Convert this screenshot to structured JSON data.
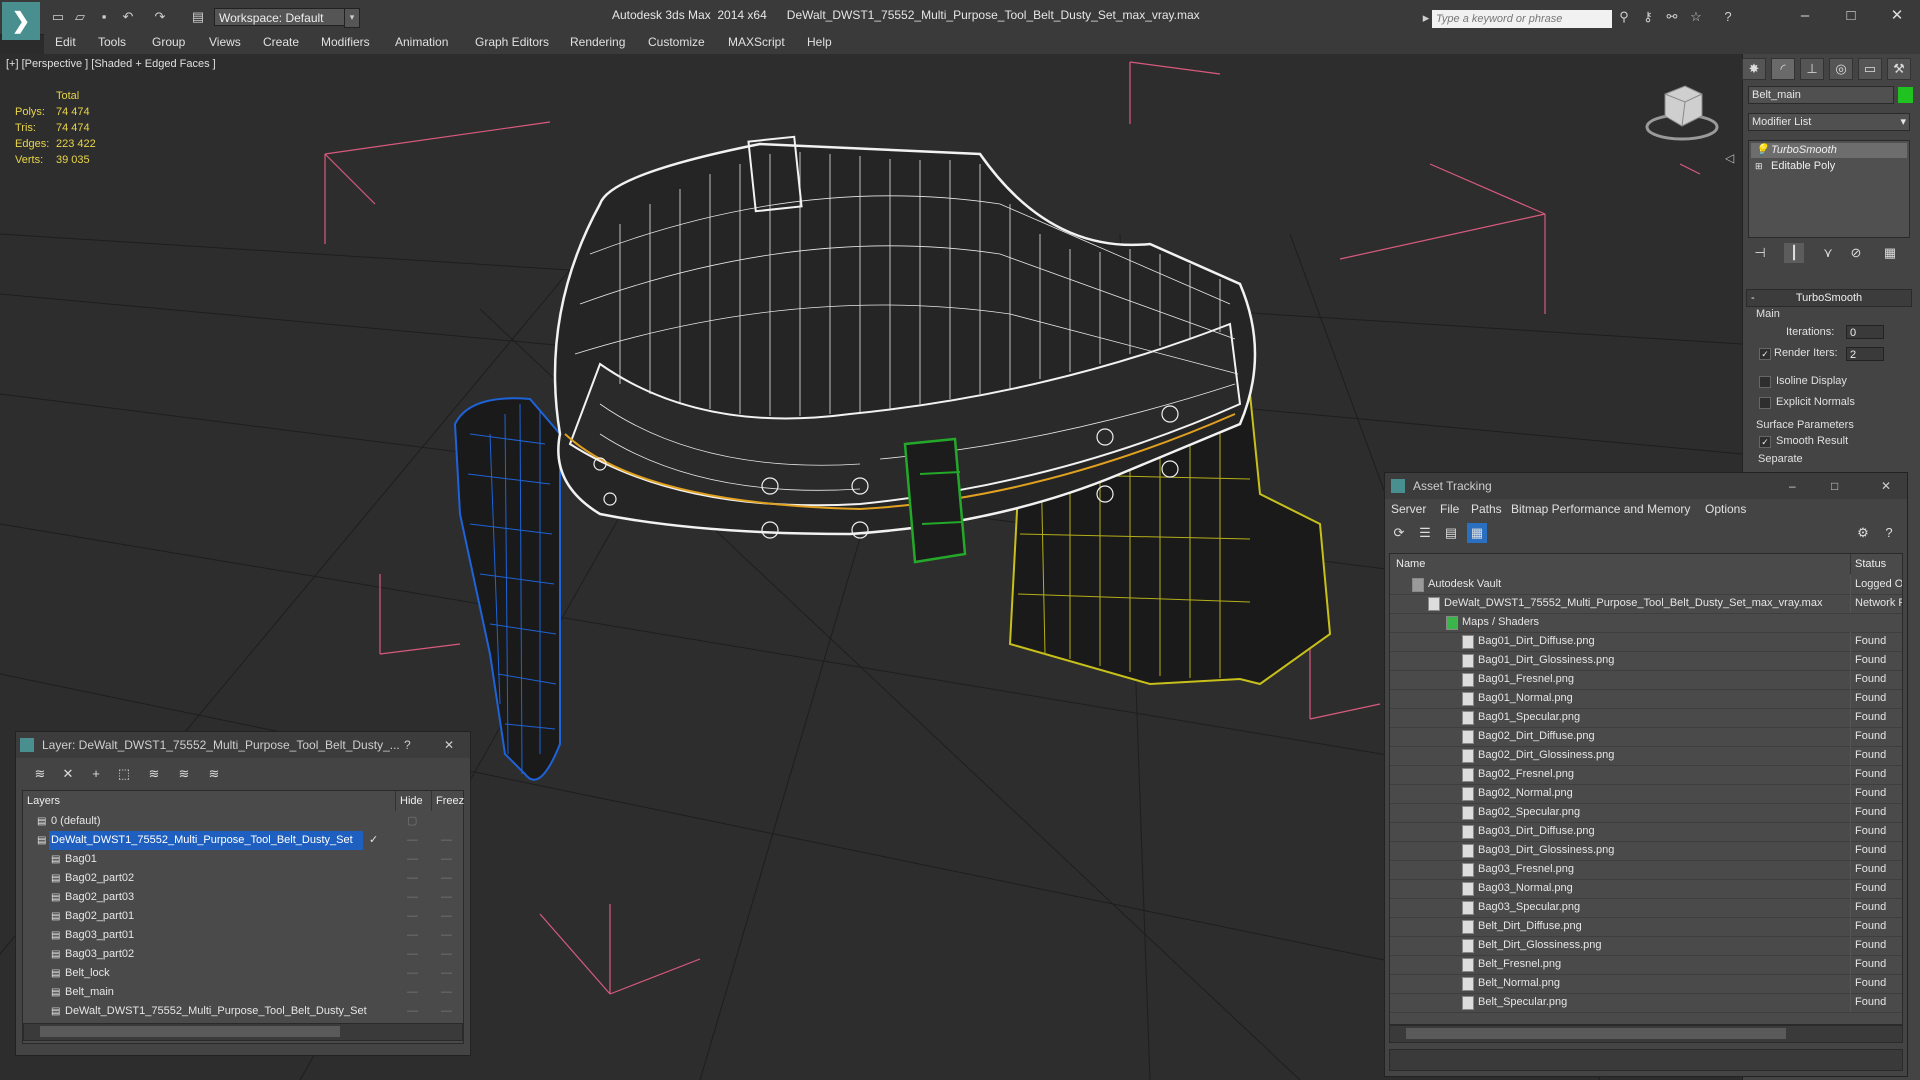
{
  "titlebar": {
    "workspace": "Workspace: Default",
    "app_title": "Autodesk 3ds Max  2014 x64",
    "file_title": "DeWalt_DWST1_75552_Multi_Purpose_Tool_Belt_Dusty_Set_max_vray.max",
    "search_placeholder": "Type a keyword or phrase"
  },
  "menu": [
    "Edit",
    "Tools",
    "Group",
    "Views",
    "Create",
    "Modifiers",
    "Animation",
    "Graph Editors",
    "Rendering",
    "Customize",
    "MAXScript",
    "Help"
  ],
  "viewport": {
    "label": "[+] [Perspective ] [Shaded + Edged Faces ]",
    "stats_header": "Total",
    "stats": [
      {
        "label": "Polys:",
        "value": "74 474"
      },
      {
        "label": "Tris:",
        "value": "74 474"
      },
      {
        "label": "Edges:",
        "value": "223 422"
      },
      {
        "label": "Verts:",
        "value": "39 035"
      }
    ]
  },
  "command_panel": {
    "object_name": "Belt_main",
    "object_color": "#1fc21f",
    "modifier_list": "Modifier List",
    "stack": [
      "TurboSmooth",
      "Editable Poly"
    ],
    "rollout": "TurboSmooth",
    "main_group": "Main",
    "iterations_label": "Iterations:",
    "iterations_value": "0",
    "render_iters_label": "Render Iters:",
    "render_iters_value": "2",
    "isoline": "Isoline Display",
    "explicit_normals": "Explicit Normals",
    "surface_group": "Surface Parameters",
    "smooth_result": "Smooth Result",
    "separate": "Separate"
  },
  "layer_window": {
    "title": "Layer: DeWalt_DWST1_75552_Multi_Purpose_Tool_Belt_Dusty_...",
    "col_layers": "Layers",
    "col_hide": "Hide",
    "col_freeze": "Freeze",
    "rows": [
      {
        "name": "0 (default)",
        "indent": 1,
        "selected": false
      },
      {
        "name": "DeWalt_DWST1_75552_Multi_Purpose_Tool_Belt_Dusty_Set",
        "indent": 1,
        "selected": true
      },
      {
        "name": "Bag01",
        "indent": 2,
        "selected": false
      },
      {
        "name": "Bag02_part02",
        "indent": 2,
        "selected": false
      },
      {
        "name": "Bag02_part03",
        "indent": 2,
        "selected": false
      },
      {
        "name": "Bag02_part01",
        "indent": 2,
        "selected": false
      },
      {
        "name": "Bag03_part01",
        "indent": 2,
        "selected": false
      },
      {
        "name": "Bag03_part02",
        "indent": 2,
        "selected": false
      },
      {
        "name": "Belt_lock",
        "indent": 2,
        "selected": false
      },
      {
        "name": "Belt_main",
        "indent": 2,
        "selected": false
      },
      {
        "name": "DeWalt_DWST1_75552_Multi_Purpose_Tool_Belt_Dusty_Set",
        "indent": 2,
        "selected": false
      }
    ]
  },
  "asset_window": {
    "title": "Asset Tracking",
    "menu": [
      "Server",
      "File",
      "Paths",
      "Bitmap Performance and Memory",
      "Options"
    ],
    "col_name": "Name",
    "col_status": "Status",
    "rows": [
      {
        "name": "Autodesk Vault",
        "status": "Logged Ou",
        "level": 0
      },
      {
        "name": "DeWalt_DWST1_75552_Multi_Purpose_Tool_Belt_Dusty_Set_max_vray.max",
        "status": "Network P",
        "level": 1
      },
      {
        "name": "Maps / Shaders",
        "status": "",
        "level": 2
      },
      {
        "name": "Bag01_Dirt_Diffuse.png",
        "status": "Found",
        "level": 3
      },
      {
        "name": "Bag01_Dirt_Glossiness.png",
        "status": "Found",
        "level": 3
      },
      {
        "name": "Bag01_Fresnel.png",
        "status": "Found",
        "level": 3
      },
      {
        "name": "Bag01_Normal.png",
        "status": "Found",
        "level": 3
      },
      {
        "name": "Bag01_Specular.png",
        "status": "Found",
        "level": 3
      },
      {
        "name": "Bag02_Dirt_Diffuse.png",
        "status": "Found",
        "level": 3
      },
      {
        "name": "Bag02_Dirt_Glossiness.png",
        "status": "Found",
        "level": 3
      },
      {
        "name": "Bag02_Fresnel.png",
        "status": "Found",
        "level": 3
      },
      {
        "name": "Bag02_Normal.png",
        "status": "Found",
        "level": 3
      },
      {
        "name": "Bag02_Specular.png",
        "status": "Found",
        "level": 3
      },
      {
        "name": "Bag03_Dirt_Diffuse.png",
        "status": "Found",
        "level": 3
      },
      {
        "name": "Bag03_Dirt_Glossiness.png",
        "status": "Found",
        "level": 3
      },
      {
        "name": "Bag03_Fresnel.png",
        "status": "Found",
        "level": 3
      },
      {
        "name": "Bag03_Normal.png",
        "status": "Found",
        "level": 3
      },
      {
        "name": "Bag03_Specular.png",
        "status": "Found",
        "level": 3
      },
      {
        "name": "Belt_Dirt_Diffuse.png",
        "status": "Found",
        "level": 3
      },
      {
        "name": "Belt_Dirt_Glossiness.png",
        "status": "Found",
        "level": 3
      },
      {
        "name": "Belt_Fresnel.png",
        "status": "Found",
        "level": 3
      },
      {
        "name": "Belt_Normal.png",
        "status": "Found",
        "level": 3
      },
      {
        "name": "Belt_Specular.png",
        "status": "Found",
        "level": 3
      }
    ]
  }
}
